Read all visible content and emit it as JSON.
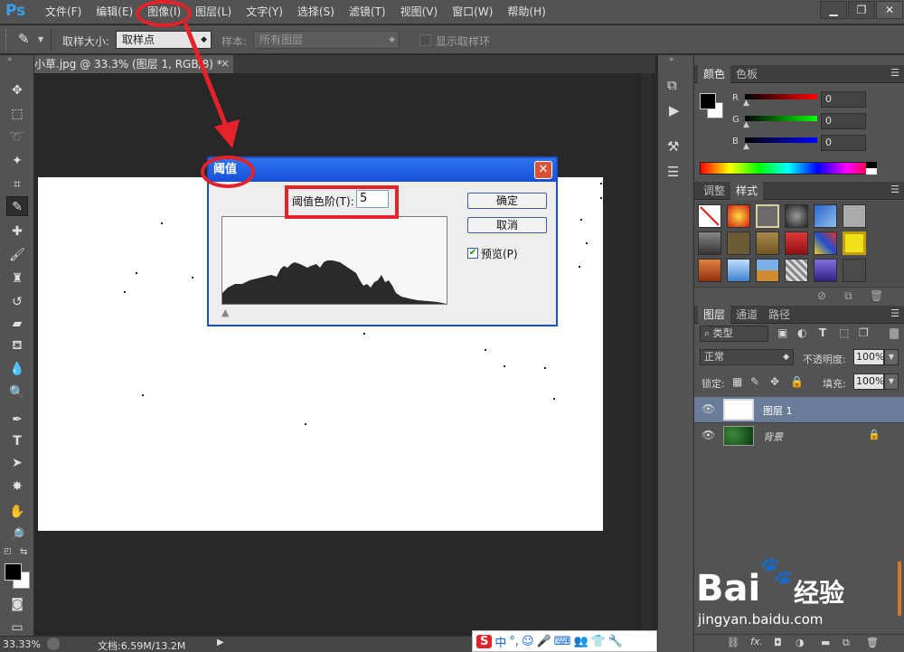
{
  "app": {
    "logo": "Ps"
  },
  "menu": [
    "文件(F)",
    "编辑(E)",
    "图像(I)",
    "图层(L)",
    "文字(Y)",
    "选择(S)",
    "滤镜(T)",
    "视图(V)",
    "窗口(W)",
    "帮助(H)"
  ],
  "options": {
    "sample_size_label": "取样大小:",
    "sample_size_value": "取样点",
    "sample_label": "样本:",
    "sample_value": "所有图层",
    "show_ring_label": "显示取样环"
  },
  "document": {
    "tab_title": "小草.jpg @ 33.3% (图层 1, RGB/8) *",
    "close_glyph": "×"
  },
  "status": {
    "zoom": "33.33%",
    "doc_info": "文档:6.59M/13.2M"
  },
  "color_panel": {
    "tabs": [
      "颜色",
      "色板"
    ],
    "channels": [
      {
        "name": "R",
        "value": "0",
        "color": "#e02020"
      },
      {
        "name": "G",
        "value": "0",
        "color": "#20c020"
      },
      {
        "name": "B",
        "value": "0",
        "color": "#2040e0"
      }
    ]
  },
  "styles_panel": {
    "tabs": [
      "调整",
      "样式"
    ]
  },
  "layers_panel": {
    "tabs": [
      "图层",
      "通道",
      "路径"
    ],
    "filter_label": "类型",
    "blend_mode": "正常",
    "opacity_label": "不透明度:",
    "opacity_value": "100%",
    "lock_label": "锁定:",
    "fill_label": "填充:",
    "fill_value": "100%",
    "layers": [
      {
        "name": "图层 1",
        "selected": true,
        "locked": false
      },
      {
        "name": "背景",
        "selected": false,
        "locked": true
      }
    ],
    "footer_fx": "fx."
  },
  "dialog": {
    "title": "阈值",
    "close_glyph": "✕",
    "level_label": "阈值色阶(T):",
    "level_value": "5",
    "ok_label": "确定",
    "cancel_label": "取消",
    "preview_label": "预览(P)",
    "preview_checked": true
  },
  "ime": {
    "items": [
      "S",
      "中",
      "°,",
      "☺",
      "🎤",
      "⌨",
      "👥",
      "👕",
      "🔧"
    ]
  },
  "watermark": {
    "line1": "Bai",
    "line2": "经验",
    "url": "jingyan.baidu.com"
  },
  "colors": {
    "accent_red": "#e5222a",
    "dialog_blue": "#1a4fc8",
    "ps_blue": "#3aa0ec"
  }
}
